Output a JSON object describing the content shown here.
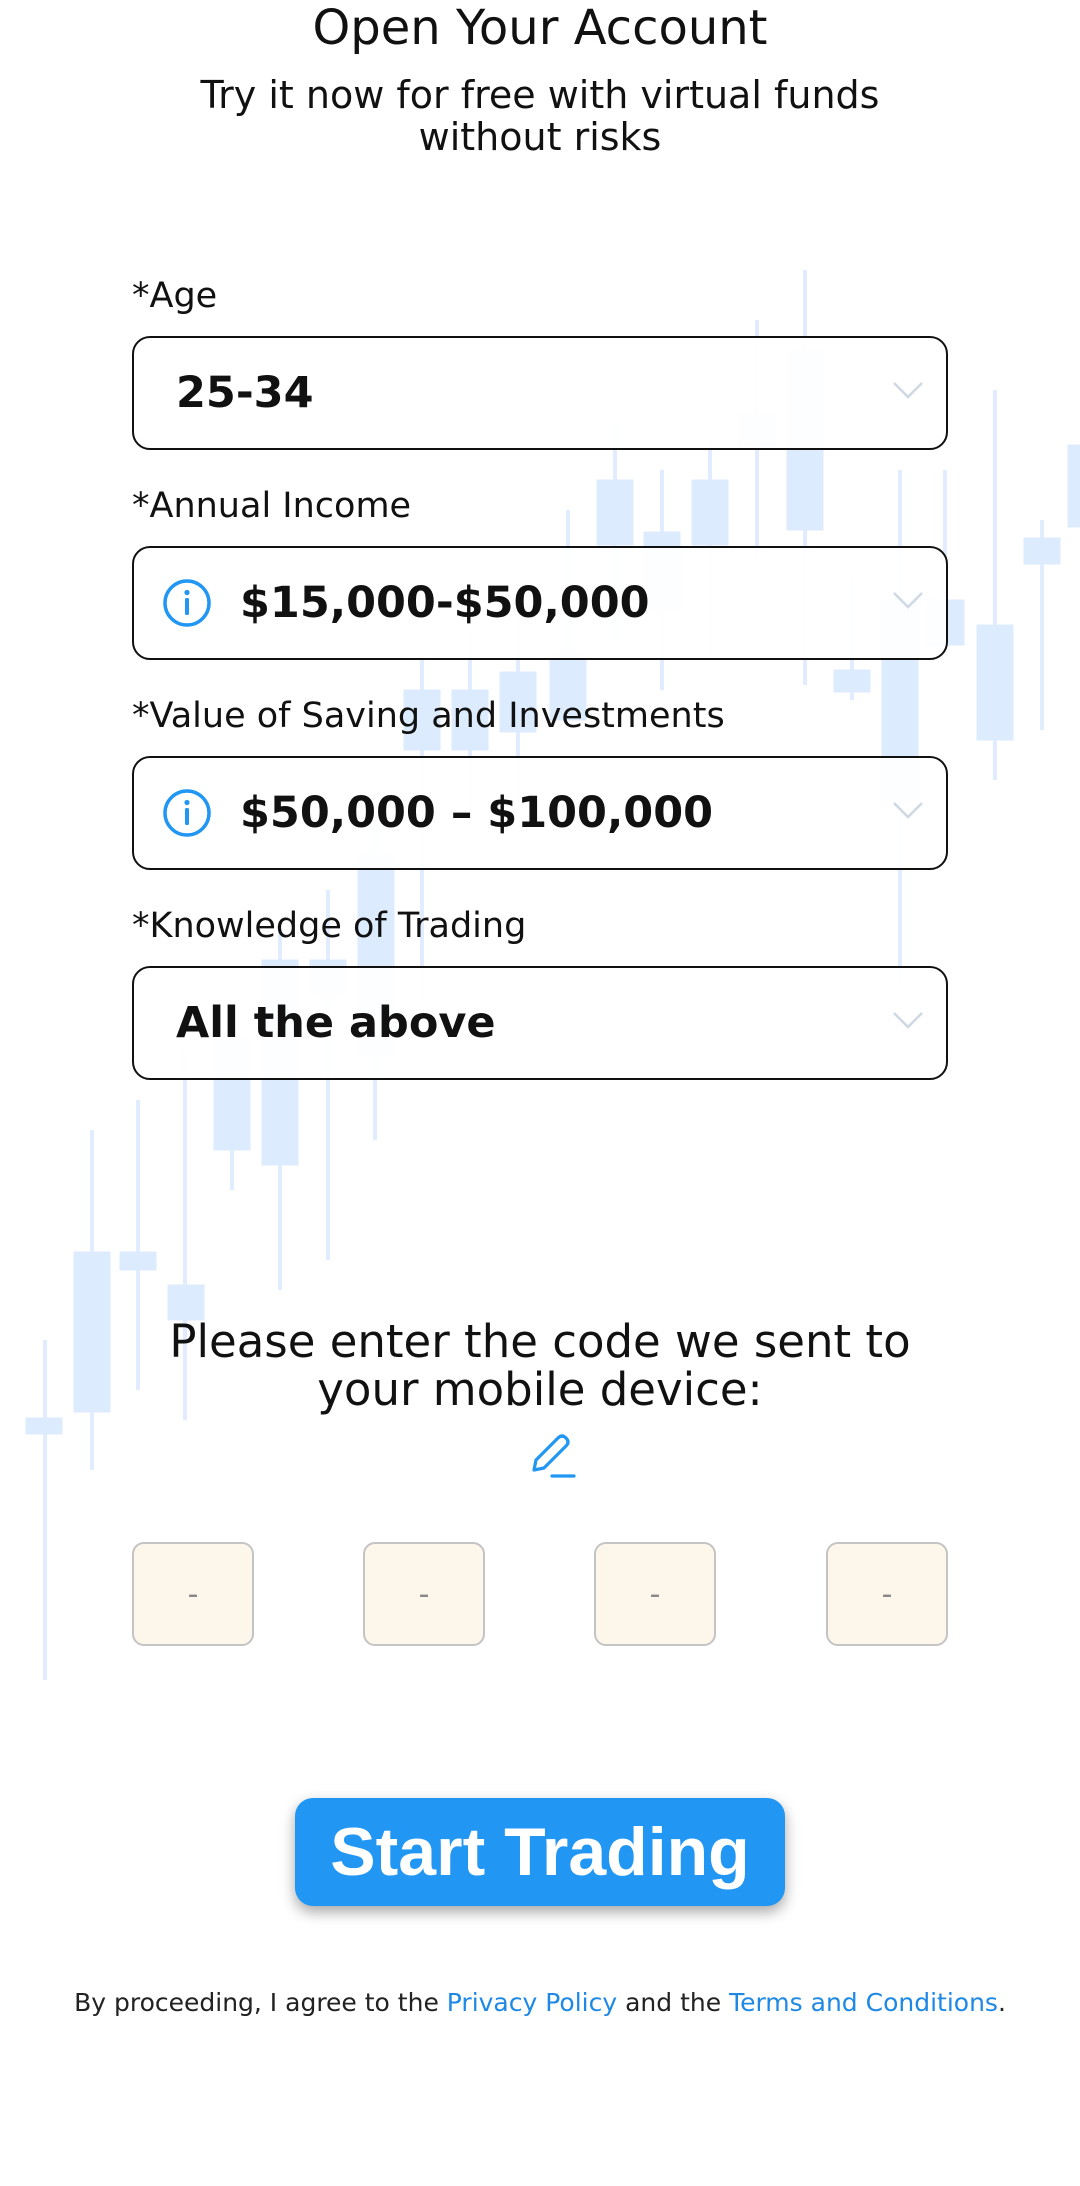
{
  "header": {
    "title": "Open Your Account",
    "subtitle": "Try it now for free with virtual funds without risks"
  },
  "form": {
    "age": {
      "label": "*Age",
      "value": "25-34"
    },
    "income": {
      "label": "*Annual Income",
      "value": "$15,000-$50,000"
    },
    "savings": {
      "label": "*Value of Saving and Investments",
      "value": "$50,000 – $100,000"
    },
    "knowledge": {
      "label": "*Knowledge of Trading",
      "value": "All the above"
    }
  },
  "verification": {
    "prompt": "Please enter the code we sent to your mobile device:",
    "digits": [
      "-",
      "-",
      "-",
      "-"
    ]
  },
  "cta": {
    "label": "Start Trading"
  },
  "legal": {
    "prefix": "By proceeding, I agree to the ",
    "privacy": "Privacy Policy",
    "middle": " and the ",
    "terms": "Terms and Conditions",
    "suffix": "."
  },
  "icons": {
    "info": "info-circle-icon",
    "chevron": "chevron-down-icon",
    "edit": "pencil-icon"
  },
  "colors": {
    "accent": "#2196f3",
    "link": "#1e88e5",
    "code_box_bg": "#fdf6ea",
    "chart_bg": "#dcebfe"
  }
}
